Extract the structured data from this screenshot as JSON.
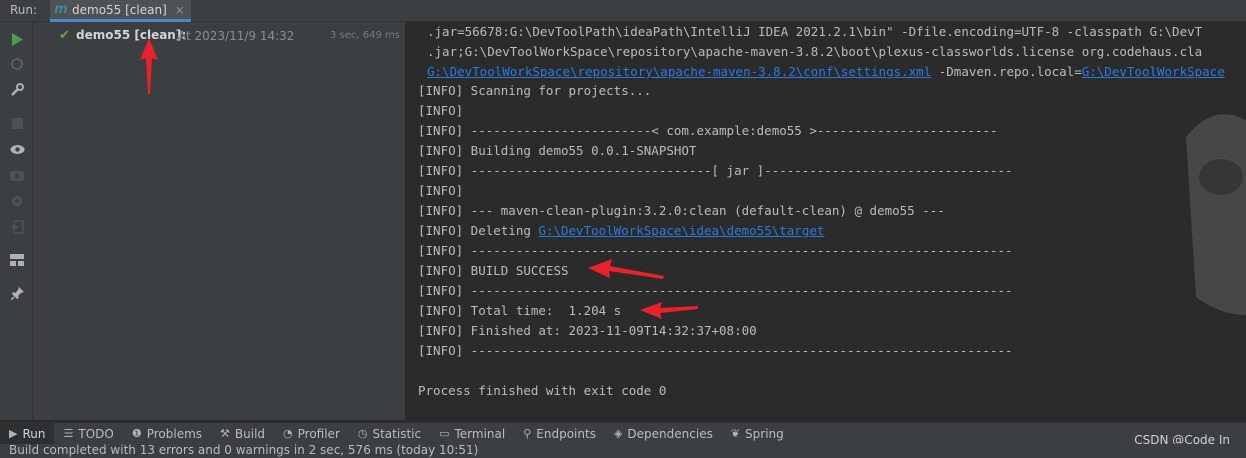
{
  "topbar": {
    "run_label": "Run:",
    "tab_label": "demo55 [clean]",
    "tab_icon": "maven-m-icon",
    "tab_close": "×"
  },
  "tree": {
    "name": "demo55 [clean]:",
    "when": "At 2023/11/9 14:32",
    "duration": "3 sec, 649 ms"
  },
  "console": {
    "lines": [
      ".jar=56678:G:\\DevToolPath\\ideaPath\\IntelliJ IDEA 2021.2.1\\bin\" -Dfile.encoding=UTF-8 -classpath G:\\DevT",
      ".jar;G:\\DevToolWorkSpace\\repository\\apache-maven-3.8.2\\boot\\plexus-classworlds.license org.codehaus.cla",
      "[INFO] Scanning for projects...",
      "[INFO]",
      "[INFO] ------------------------< com.example:demo55 >------------------------",
      "[INFO] Building demo55 0.0.1-SNAPSHOT",
      "[INFO] --------------------------------[ jar ]---------------------------------",
      "[INFO]",
      "[INFO] --- maven-clean-plugin:3.2.0:clean (default-clean) @ demo55 ---",
      "[INFO] Deleting ",
      "[INFO] ------------------------------------------------------------------------",
      "[INFO] BUILD SUCCESS",
      "[INFO] ------------------------------------------------------------------------",
      "[INFO] Total time:  1.204 s",
      "[INFO] Finished at: 2023-11-09T14:32:37+08:00",
      "[INFO] ------------------------------------------------------------------------",
      "",
      "Process finished with exit code 0"
    ],
    "settings_link": "G:\\DevToolWorkSpace\\repository\\apache-maven-3.8.2\\conf\\settings.xml",
    "repo_flag": " -Dmaven.repo.local=",
    "repo_link": "G:\\DevToolWorkSpace",
    "target_link": "G:\\DevToolWorkSpace\\idea\\demo55\\target"
  },
  "bottom_tabs": [
    {
      "label": "Run",
      "icon": "play-icon"
    },
    {
      "label": "TODO",
      "icon": "list-icon"
    },
    {
      "label": "Problems",
      "icon": "problems-icon"
    },
    {
      "label": "Build",
      "icon": "hammer-icon"
    },
    {
      "label": "Profiler",
      "icon": "profiler-icon"
    },
    {
      "label": "Statistic",
      "icon": "statistic-icon"
    },
    {
      "label": "Terminal",
      "icon": "terminal-icon"
    },
    {
      "label": "Endpoints",
      "icon": "endpoints-icon"
    },
    {
      "label": "Dependencies",
      "icon": "dependencies-icon"
    },
    {
      "label": "Spring",
      "icon": "spring-icon"
    }
  ],
  "status": {
    "text": "Build completed with 13 errors and 0 warnings in 2 sec, 576 ms (today 10:51)"
  },
  "watermark": "CSDN @Code In",
  "colors": {
    "accent_tab": "#4a88c7",
    "success": "#5eab46",
    "link": "#287bde",
    "arrow": "#e8222a"
  }
}
